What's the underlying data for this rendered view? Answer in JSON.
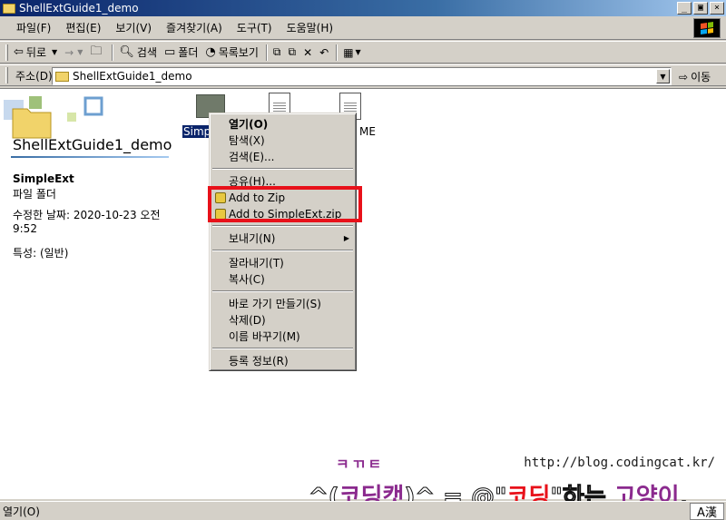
{
  "window": {
    "title": "ShellExtGuide1_demo",
    "buttons": [
      "_",
      "▣",
      "×"
    ]
  },
  "menubar": [
    "파일(F)",
    "편집(E)",
    "보기(V)",
    "즐겨찾기(A)",
    "도구(T)",
    "도움말(H)"
  ],
  "toolbar": {
    "back": "뒤로",
    "forward": "→",
    "search": "검색",
    "folders": "폴더",
    "history": "목록보기"
  },
  "address": {
    "label": "주소(D)",
    "value": "ShellExtGuide1_demo",
    "go": "이동"
  },
  "left_panel": {
    "folder_title": "ShellExtGuide1_demo",
    "item_name": "SimpleExt",
    "item_type": "파일 폴더",
    "modified": "수정한 날짜: 2020-10-23 오전 9:52",
    "attributes": "특성: (일반)"
  },
  "files": [
    {
      "label": "Simp",
      "selected": true
    },
    {
      "label": "",
      "selected": false
    },
    {
      "label": "ME",
      "selected": false
    }
  ],
  "context_menu": {
    "items": [
      {
        "label": "열기(O)",
        "bold": true
      },
      {
        "label": "탐색(X)"
      },
      {
        "label": "검색(E)..."
      },
      {
        "label": "공유(H)..."
      },
      {
        "label": "Add to Zip",
        "icon": "zip-icon"
      },
      {
        "label": "Add to SimpleExt.zip",
        "icon": "zip-icon"
      },
      {
        "label": "보내기(N)",
        "submenu": true
      },
      {
        "label": "잘라내기(T)"
      },
      {
        "label": "복사(C)"
      },
      {
        "label": "바로 가기 만들기(S)"
      },
      {
        "label": "삭제(D)"
      },
      {
        "label": "이름 바꾸기(M)"
      },
      {
        "label": "등록 정보(R)"
      }
    ]
  },
  "statusbar": {
    "text": "열기(O)",
    "ime": "A漢"
  },
  "watermark": {
    "url": "http://blog.codingcat.kr/",
    "top": "ㅋㄲㅌ",
    "line_a": "^(",
    "line_b": "코딩캣",
    "line_c": ")^ = @\"",
    "line_d": "코딩",
    "line_e": "\"하는 ",
    "line_f": "고양이",
    "line_g": "."
  },
  "colors": {
    "title_gradient_start": "#0a246a",
    "selection": "#0a246a",
    "highlight_box": "#e8111a"
  }
}
